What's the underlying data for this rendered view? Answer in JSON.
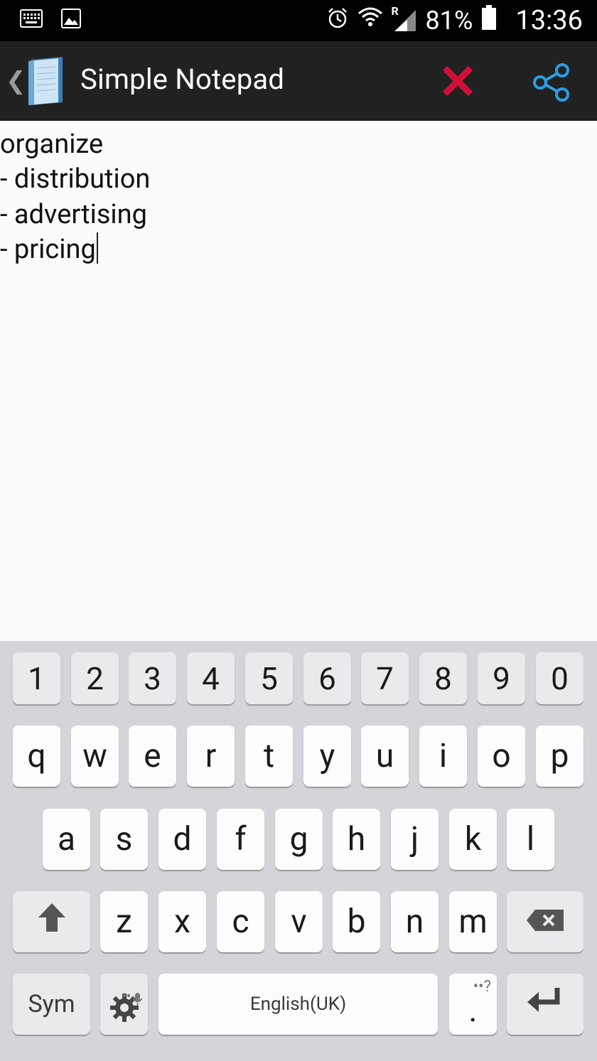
{
  "status_bar": {
    "battery": "81%",
    "time": "13:36",
    "signal_roaming": "R"
  },
  "app_bar": {
    "title": "Simple Notepad"
  },
  "note": {
    "lines": [
      "organize",
      "- distribution",
      "- advertising",
      "- pricing"
    ]
  },
  "keyboard": {
    "number_row": [
      "1",
      "2",
      "3",
      "4",
      "5",
      "6",
      "7",
      "8",
      "9",
      "0"
    ],
    "row1": [
      "q",
      "w",
      "e",
      "r",
      "t",
      "y",
      "u",
      "i",
      "o",
      "p"
    ],
    "row2": [
      "a",
      "s",
      "d",
      "f",
      "g",
      "h",
      "j",
      "k",
      "l"
    ],
    "row3": [
      "z",
      "x",
      "c",
      "v",
      "b",
      "n",
      "m"
    ],
    "sym_label": "Sym",
    "space_label": "English(UK)",
    "period_label": ".",
    "period_hint": "?"
  },
  "colors": {
    "delete_icon": "#d0103a",
    "share_icon": "#2a9fe0"
  }
}
